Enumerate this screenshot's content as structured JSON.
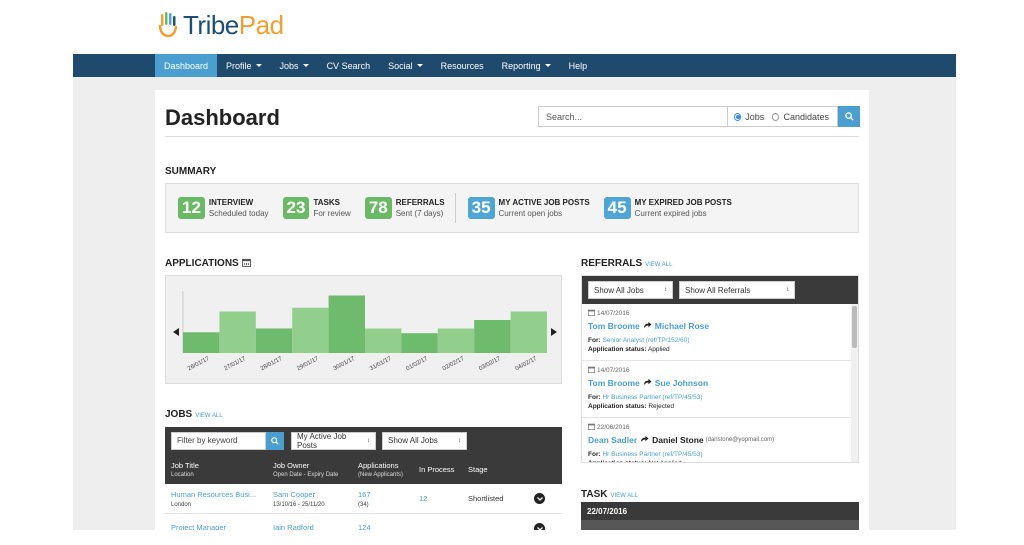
{
  "brand": {
    "name_part1": "Tribe",
    "name_part2": "Pad"
  },
  "nav": {
    "items": [
      {
        "label": "Dashboard",
        "active": true,
        "dropdown": false
      },
      {
        "label": "Profile",
        "active": false,
        "dropdown": true
      },
      {
        "label": "Jobs",
        "active": false,
        "dropdown": true
      },
      {
        "label": "CV Search",
        "active": false,
        "dropdown": false
      },
      {
        "label": "Social",
        "active": false,
        "dropdown": true
      },
      {
        "label": "Resources",
        "active": false,
        "dropdown": false
      },
      {
        "label": "Reporting",
        "active": false,
        "dropdown": true
      },
      {
        "label": "Help",
        "active": false,
        "dropdown": false
      }
    ]
  },
  "header": {
    "title": "Dashboard",
    "search_placeholder": "Search...",
    "radio_jobs": "Jobs",
    "radio_candidates": "Candidates",
    "selected_scope": "Jobs"
  },
  "summary": {
    "title": "SUMMARY",
    "stats": [
      {
        "value": "12",
        "label": "INTERVIEW",
        "sub": "Scheduled today",
        "color": "#6aba65"
      },
      {
        "value": "23",
        "label": "TASKS",
        "sub": "For review",
        "color": "#6aba65"
      },
      {
        "value": "78",
        "label": "REFERRALS",
        "sub": "Sent (7 days)",
        "color": "#6aba65"
      },
      {
        "value": "35",
        "label": "MY ACTIVE JOB POSTS",
        "sub": "Current open jobs",
        "color": "#4fa5d6"
      },
      {
        "value": "45",
        "label": "MY EXPIRED JOB POSTS",
        "sub": "Current expired jobs",
        "color": "#4fa5d6"
      }
    ]
  },
  "applications": {
    "title": "APPLICATIONS"
  },
  "chart_data": {
    "type": "bar",
    "title": "APPLICATIONS",
    "categories": [
      "26/01/17",
      "27/01/17",
      "28/01/17",
      "29/01/17",
      "30/01/17",
      "31/01/17",
      "01/02/17",
      "02/02/17",
      "03/02/17",
      "04/02/17"
    ],
    "values": [
      22,
      44,
      26,
      48,
      61,
      26,
      21,
      26,
      35,
      44
    ],
    "ylim": [
      0,
      70
    ],
    "colors": [
      "#6fbb6d",
      "#93cf8c"
    ],
    "grid": false,
    "legend": "none"
  },
  "jobs": {
    "title": "JOBS",
    "view_all": "VIEW ALL",
    "filter_placeholder": "Filter by keyword",
    "select_posts": "My Active Job Posts",
    "select_jobs": "Show All Jobs",
    "columns": {
      "title": "Job Title",
      "title_sub": "Location",
      "owner": "Job Owner",
      "owner_sub": "Open Date - Expiry Date",
      "apps": "Applications",
      "apps_sub": "(New Applicants)",
      "process": "In Process",
      "stage": "Stage"
    },
    "rows": [
      {
        "title": "Human Resources Busi...",
        "location": "London",
        "owner": "Sam Cooper",
        "dates": "13/10/16 - 25/11/20",
        "apps": "167",
        "new": "(34)",
        "process": "12",
        "stage": "Shortlisted"
      },
      {
        "title": "Project Manager",
        "location": "",
        "owner": "Iain Radford",
        "dates": "",
        "apps": "124",
        "new": "",
        "process": "",
        "stage": ""
      }
    ]
  },
  "referrals": {
    "title": "REFERRALS",
    "view_all": "VIEW ALL",
    "select_jobs": "Show All Jobs",
    "select_refs": "Show All Referrals",
    "for_label": "For:",
    "status_label": "Application status:",
    "items": [
      {
        "date": "14/07/2016",
        "from": "Tom Broome",
        "to": "Michael Rose",
        "to_email": "",
        "job": "Senior Analyst (ref/TP/152/60)",
        "status": "Applied",
        "from_link": true
      },
      {
        "date": "14/07/2016",
        "from": "Tom Broome",
        "to": "Sue Johnson",
        "to_email": "",
        "job": "Hr Business Partner (ref/TP/45/53)",
        "status": "Rejected",
        "from_link": true
      },
      {
        "date": "22/06/2016",
        "from": "Dean Sadler",
        "to": "Daniel Stone",
        "to_email": "(danstone@yopmail.com)",
        "job": "Hr Business Partner (ref/TP/45/53)",
        "status": "Not Applied",
        "from_link": true
      }
    ]
  },
  "task": {
    "title": "TASK",
    "view_all": "VIEW ALL",
    "date": "22/07/2016"
  }
}
